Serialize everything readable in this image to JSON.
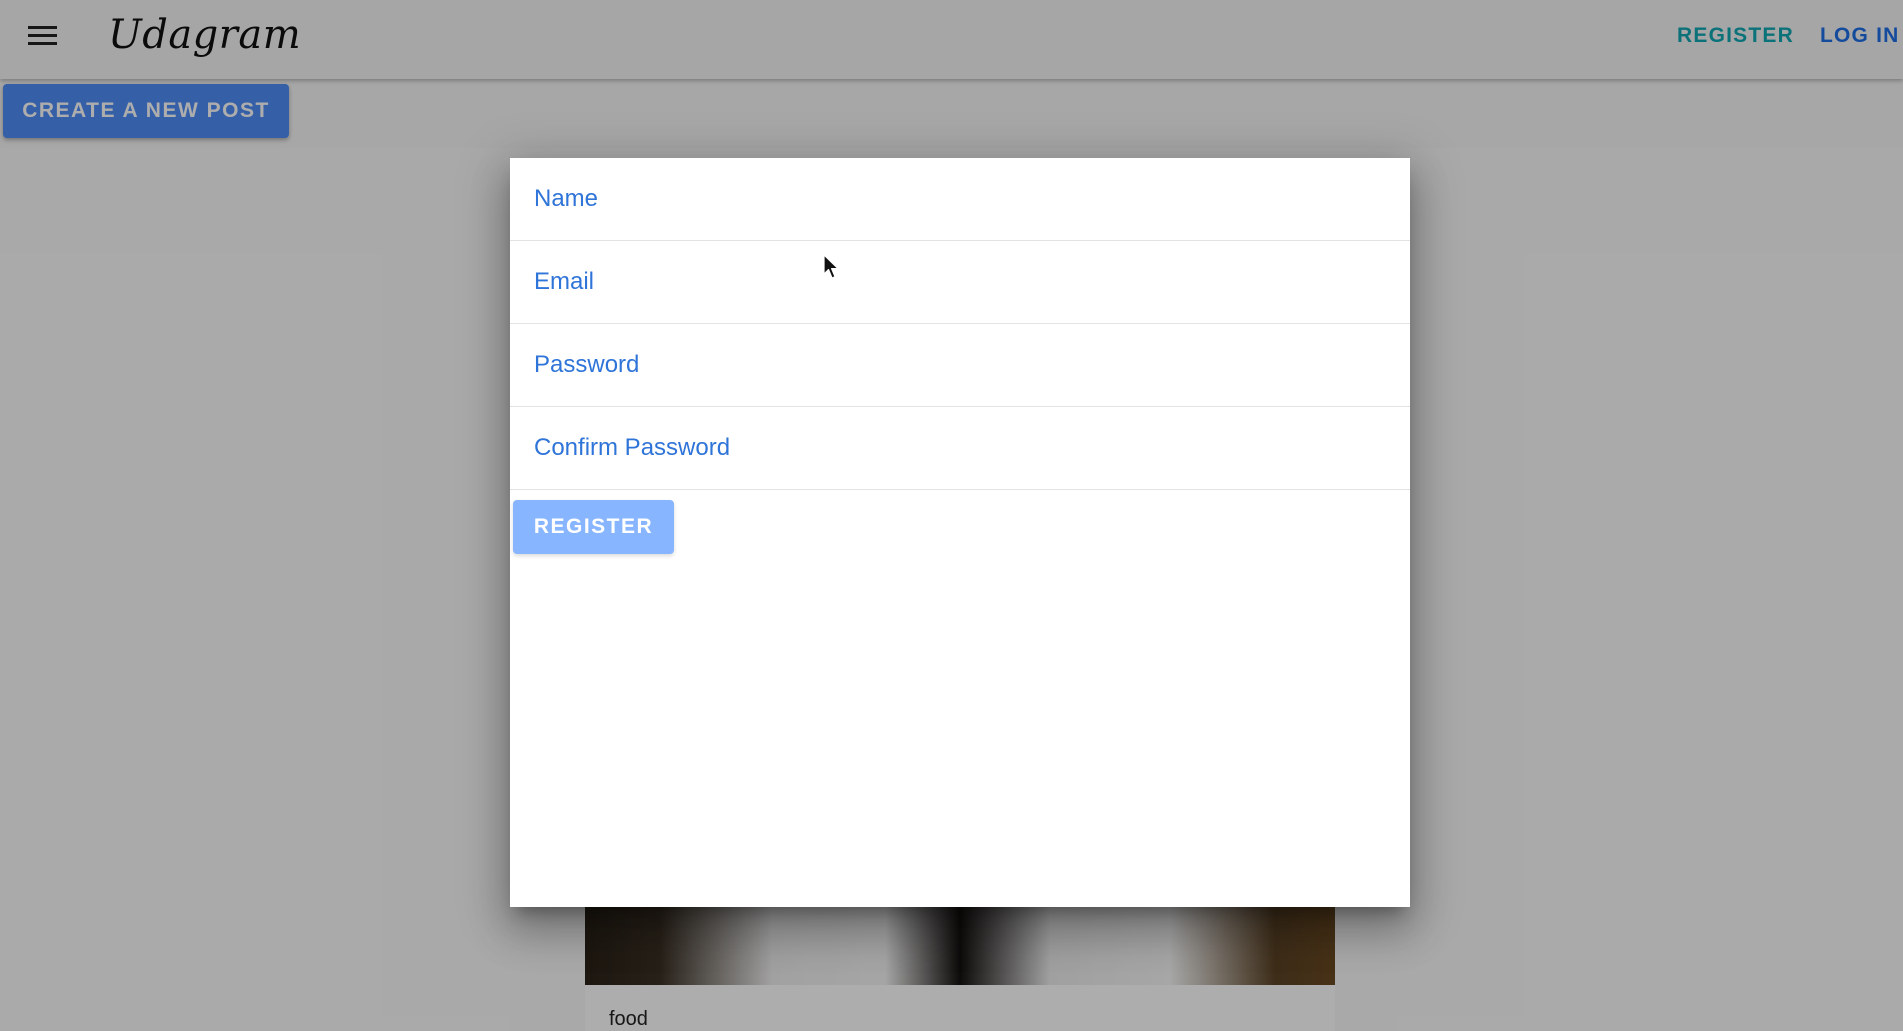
{
  "header": {
    "menu_icon": "hamburger-menu-icon",
    "brand": "Udagram",
    "links": {
      "register": "REGISTER",
      "login": "LOG IN"
    }
  },
  "toolbar": {
    "create_post_label": "CREATE A NEW POST"
  },
  "register_dialog": {
    "fields": {
      "name": {
        "placeholder": "Name",
        "value": ""
      },
      "email": {
        "placeholder": "Email",
        "value": ""
      },
      "password": {
        "placeholder": "Password",
        "value": ""
      },
      "confirm_password": {
        "placeholder": "Confirm Password",
        "value": ""
      }
    },
    "submit_label": "REGISTER"
  },
  "feed": {
    "items": [
      {
        "caption": "food"
      }
    ]
  },
  "colors": {
    "primary": "#4f8ef7",
    "register_link": "#11a8b3",
    "login_link": "#1f6fe6",
    "register_button_disabled": "#88b5ff"
  },
  "cursor_icon": "mouse-pointer-icon"
}
